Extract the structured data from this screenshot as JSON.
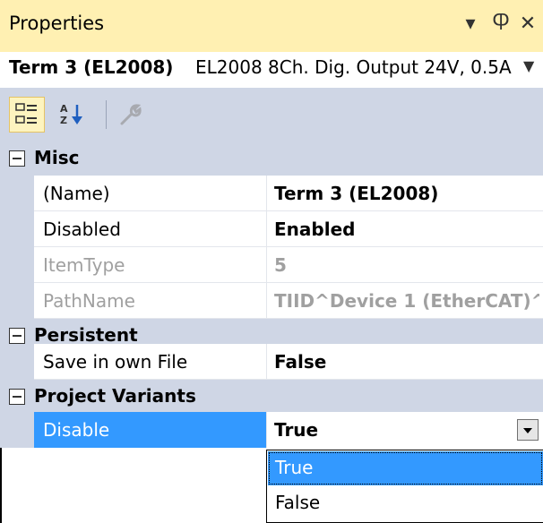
{
  "panel": {
    "title": "Properties",
    "icons": [
      "dropdown-arrow-icon",
      "pin-icon",
      "close-icon"
    ]
  },
  "object": {
    "name": "Term 3 (EL2008)",
    "description": "EL2008 8Ch. Dig. Output 24V, 0.5A"
  },
  "toolbar": {
    "buttons": [
      "categorized-icon",
      "alphabetical-icon",
      "property-pages-icon"
    ]
  },
  "grid": {
    "categories": [
      {
        "label": "Misc",
        "properties": [
          {
            "name": "(Name)",
            "value": "Term 3 (EL2008)"
          },
          {
            "name": "Disabled",
            "value": "Enabled"
          },
          {
            "name": "ItemType",
            "value": "5"
          },
          {
            "name": "PathName",
            "value": "TIID^Device 1 (EtherCAT)^"
          }
        ]
      },
      {
        "label": "Persistent",
        "properties": [
          {
            "name": "Save in own File",
            "value": "False"
          }
        ]
      },
      {
        "label": "Project Variants",
        "properties": [
          {
            "name": "Disable",
            "value": "True"
          }
        ]
      }
    ]
  },
  "dropdown": {
    "options": [
      "True",
      "False"
    ],
    "selected": "True"
  },
  "colors": {
    "titlebar": "#fff0b2",
    "category": "#cfd6e5",
    "selection": "#3399ff",
    "readonly_text": "#a0a0a0"
  }
}
